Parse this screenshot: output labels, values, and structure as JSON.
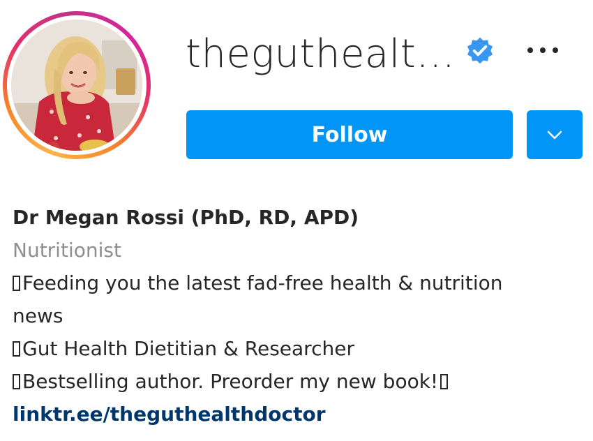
{
  "profile": {
    "username": "theguthealt…",
    "verified": true,
    "follow_label": "Follow",
    "full_name": "Dr Megan Rossi (PhD, RD, APD)",
    "category": "Nutritionist",
    "bio": {
      "line1": "Feeding you the latest fad-free health & nutrition",
      "line2": "news",
      "line3": "Gut Health Dietitian & Researcher",
      "line4": "Bestselling author. Preorder my new book!"
    },
    "website": "linktr.ee/theguthealthdoctor"
  },
  "icons": {
    "verified": "verified-badge-icon",
    "more": "more-options-icon",
    "chevron": "chevron-down-icon",
    "emoji_placeholder": "missing-emoji-glyph"
  },
  "colors": {
    "primary_button": "#0095f6",
    "verified_badge": "#3897f0",
    "text": "#262626",
    "muted_text": "#8e8e8e",
    "link": "#00376b",
    "story_ring": [
      "#fdb44b",
      "#f58529",
      "#e1306c",
      "#c13584"
    ]
  }
}
